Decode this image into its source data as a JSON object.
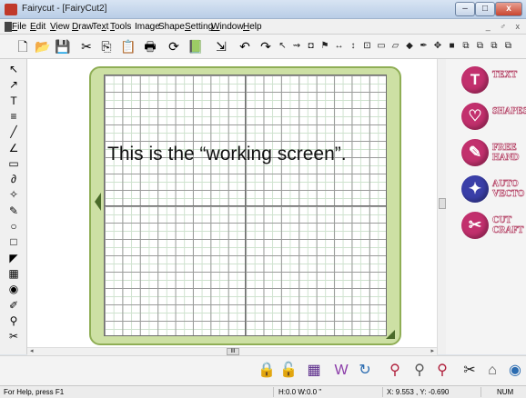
{
  "window": {
    "title": "Fairycut - [FairyCut2]",
    "minimize": "–",
    "maximize": "□",
    "close": "x"
  },
  "menu": [
    {
      "label": "File",
      "key": "F",
      "rest": "ile"
    },
    {
      "label": "Edit",
      "key": "E",
      "rest": "dit"
    },
    {
      "label": "View",
      "key": "V",
      "rest": "iew"
    },
    {
      "label": "Draw",
      "key": "D",
      "rest": "raw"
    },
    {
      "label": "Text",
      "key": "x",
      "pre": "Te",
      "rest": "t"
    },
    {
      "label": "Tools",
      "key": "T",
      "rest": "ools"
    },
    {
      "label": "Image",
      "key": "",
      "rest": "Image"
    },
    {
      "label": "Shape",
      "key": "",
      "rest": "Shape"
    },
    {
      "label": "Setting",
      "key": "S",
      "rest": "etting"
    },
    {
      "label": "Window",
      "key": "W",
      "rest": "indow"
    },
    {
      "label": "Help",
      "key": "H",
      "rest": "elp"
    }
  ],
  "mdi_controls": "_ ♂ x",
  "toolbar": {
    "icons": [
      "new-file-icon",
      "open-folder-icon",
      "save-icon",
      "cut-icon",
      "copy-icon",
      "paste-icon",
      "print-icon",
      "refresh-icon",
      "book-icon",
      "export-icon",
      "undo-icon",
      "redo-icon"
    ],
    "glyphs": [
      "🗋",
      "📂",
      "💾",
      "✂",
      "⎘",
      "📋",
      "🖶",
      "⟳",
      "📗",
      "⇲",
      "↶",
      "↷"
    ],
    "small_icons": [
      "pointer-icon",
      "node-edit-icon",
      "fill-icon",
      "weld-icon",
      "flip-horizontal-icon",
      "flip-vertical-icon",
      "align-icon",
      "group-icon",
      "eraser-icon",
      "knife-icon",
      "pen-icon",
      "move-icon",
      "color-icon",
      "arrange-icon-1",
      "arrange-icon-2",
      "arrange-icon-3",
      "arrange-icon-4"
    ],
    "small_glyphs": [
      "↖",
      "⇝",
      "◘",
      "⚑",
      "↔",
      "↕",
      "⊡",
      "▭",
      "▱",
      "◆",
      "✒",
      "✥",
      "■",
      "⧉",
      "⧉",
      "⧉",
      "⧉"
    ]
  },
  "left_tools": {
    "icons": [
      "select-arrow-icon",
      "node-arrow-icon",
      "text-tool-icon",
      "text-path-icon",
      "pen-tool-icon",
      "line-tool-icon",
      "ruler-tool-icon",
      "spiral-tool-icon",
      "shape-tool-icon",
      "pencil-tool-icon",
      "ellipse-tool-icon",
      "rectangle-tool-icon",
      "eraser-tool-icon",
      "scan-tool-icon",
      "fill-tool-icon",
      "dropper-tool-icon",
      "zoom-tool-icon",
      "knife-tool-icon"
    ],
    "glyphs": [
      "↖",
      "↗",
      "T",
      "≡",
      "╱",
      "∠",
      "▭",
      "∂",
      "✧",
      "✎",
      "○",
      "□",
      "◤",
      "▦",
      "◉",
      "✐",
      "⚲",
      "✂"
    ]
  },
  "annotation": "This is the “working screen”.",
  "side_panel": [
    {
      "icon": "text-icon",
      "glyph": "T",
      "label": "TEXT",
      "color": "#c2306d"
    },
    {
      "icon": "shapes-icon",
      "glyph": "♡",
      "label": "SHAPES",
      "color": "#c2306d"
    },
    {
      "icon": "free-hand-icon",
      "glyph": "✎",
      "label": "FREE HAND",
      "color": "#c2306d"
    },
    {
      "icon": "auto-vecto-icon",
      "glyph": "✦",
      "label": "AUTO VECTO",
      "color": "#3a3fa8"
    },
    {
      "icon": "cut-craft-icon",
      "glyph": "✂",
      "label": "CUT CRAFT",
      "color": "#c2306d"
    }
  ],
  "bottom_toolbar": {
    "icons": [
      "lock-icon",
      "unlock-icon",
      "grid-icon",
      "weld-w-icon",
      "contour-icon",
      "zoom-out-icon",
      "zoom-area-icon",
      "zoom-all-icon",
      "cutter-icon",
      "plotter-icon",
      "globe-icon"
    ],
    "glyphs": [
      "🔒",
      "🔓",
      "▦",
      "W",
      "↻",
      "⚲",
      "⚲",
      "⚲",
      "✂",
      "⌂",
      "◉"
    ],
    "colors": [
      "#b0203c",
      "#222",
      "#5a2a8a",
      "#8a3aa8",
      "#2a6bb0",
      "#b0203c",
      "#555",
      "#b0203c",
      "#222",
      "#555",
      "#2a6bb0"
    ]
  },
  "status": {
    "help": "For Help, press F1",
    "size": "H:0.0  W:0.0 \"",
    "coords": "X: 9.553 , Y: -0.690",
    "num": "NUM"
  },
  "scroll": {
    "thumb": "III"
  }
}
